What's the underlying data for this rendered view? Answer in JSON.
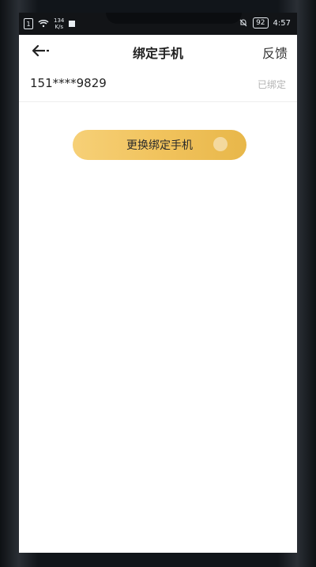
{
  "status_bar": {
    "net_speed_value": "134",
    "net_speed_unit": "K/s",
    "battery": "92",
    "time": "4:57"
  },
  "header": {
    "title": "绑定手机",
    "feedback_label": "反馈"
  },
  "phone_row": {
    "number": "151****9829",
    "status": "已绑定"
  },
  "primary_button": {
    "label": "更换绑定手机"
  },
  "colors": {
    "button_start": "#f6d077",
    "button_end": "#e8b74a",
    "muted_text": "#b3b3b3"
  }
}
